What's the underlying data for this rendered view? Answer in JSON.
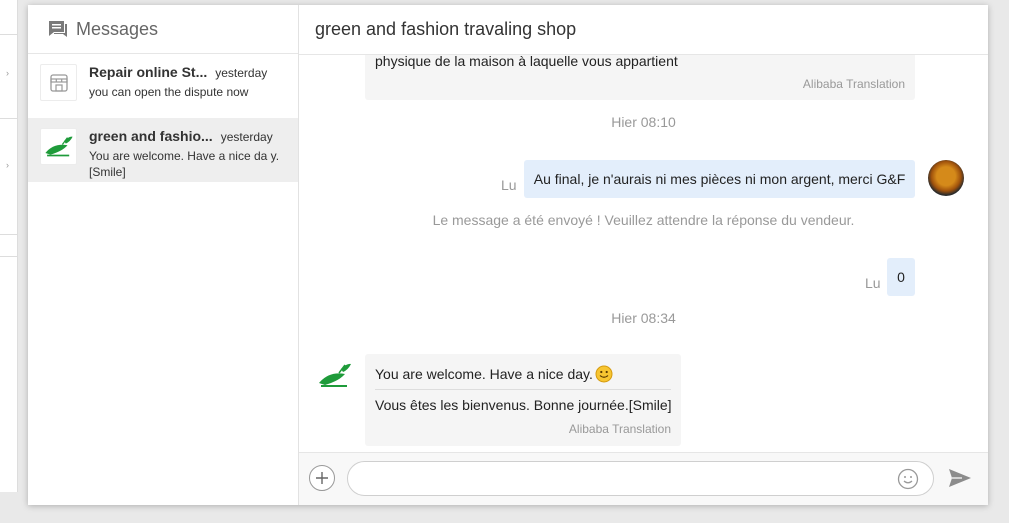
{
  "sidebar": {
    "title": "Messages",
    "conversations": [
      {
        "name": "Repair online St...",
        "time": "yesterday",
        "preview": "you can open the dispute now"
      },
      {
        "name": "green and fashio...",
        "time": "yesterday",
        "preview": "You are welcome. Have a nice da y.[Smile]"
      }
    ]
  },
  "chat": {
    "title": "green and fashion travaling shop",
    "partial_message": "physique de la maison à laquelle vous appartient",
    "partial_translation": "Alibaba Translation",
    "time1": "Hier 08:10",
    "out1": {
      "text": "Au final, je n'aurais ni mes pièces ni mon argent, merci G&F",
      "status": "Lu"
    },
    "system_note": "Le message a été envoyé ! Veuillez attendre la réponse du vendeur.",
    "out2": {
      "text": "0",
      "status": "Lu"
    },
    "time2": "Hier 08:34",
    "in2": {
      "text": "You are welcome. Have a nice day.",
      "translation": "Vous êtes les bienvenus. Bonne journée.[Smile]",
      "translation_label": "Alibaba Translation"
    }
  },
  "composer": {
    "value": "",
    "placeholder": ""
  },
  "icons": {
    "messages": "chat-bubble-icon",
    "shop": "store-icon",
    "plus": "plus-icon",
    "emoji": "smiley-icon",
    "send": "send-icon"
  },
  "colors": {
    "outgoing_bubble": "#e3eefb",
    "incoming_bubble": "#f5f5f5",
    "seller_logo": "#1e9b3a"
  }
}
